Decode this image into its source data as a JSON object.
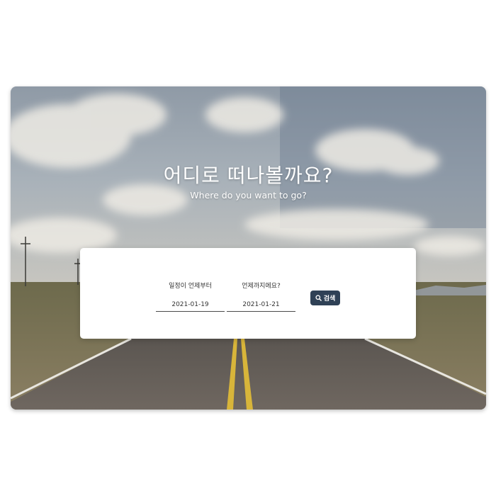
{
  "hero": {
    "title": "어디로 떠나볼까요?",
    "subtitle": "Where do you want to go?"
  },
  "search": {
    "start": {
      "label": "일정이 언제부터",
      "value": "2021-01-19"
    },
    "end": {
      "label": "언제까지에요?",
      "value": "2021-01-21"
    },
    "button": {
      "label": "검색",
      "icon": "search-icon"
    }
  },
  "colors": {
    "button_bg": "#2f4156",
    "card_bg": "#ffffff"
  }
}
